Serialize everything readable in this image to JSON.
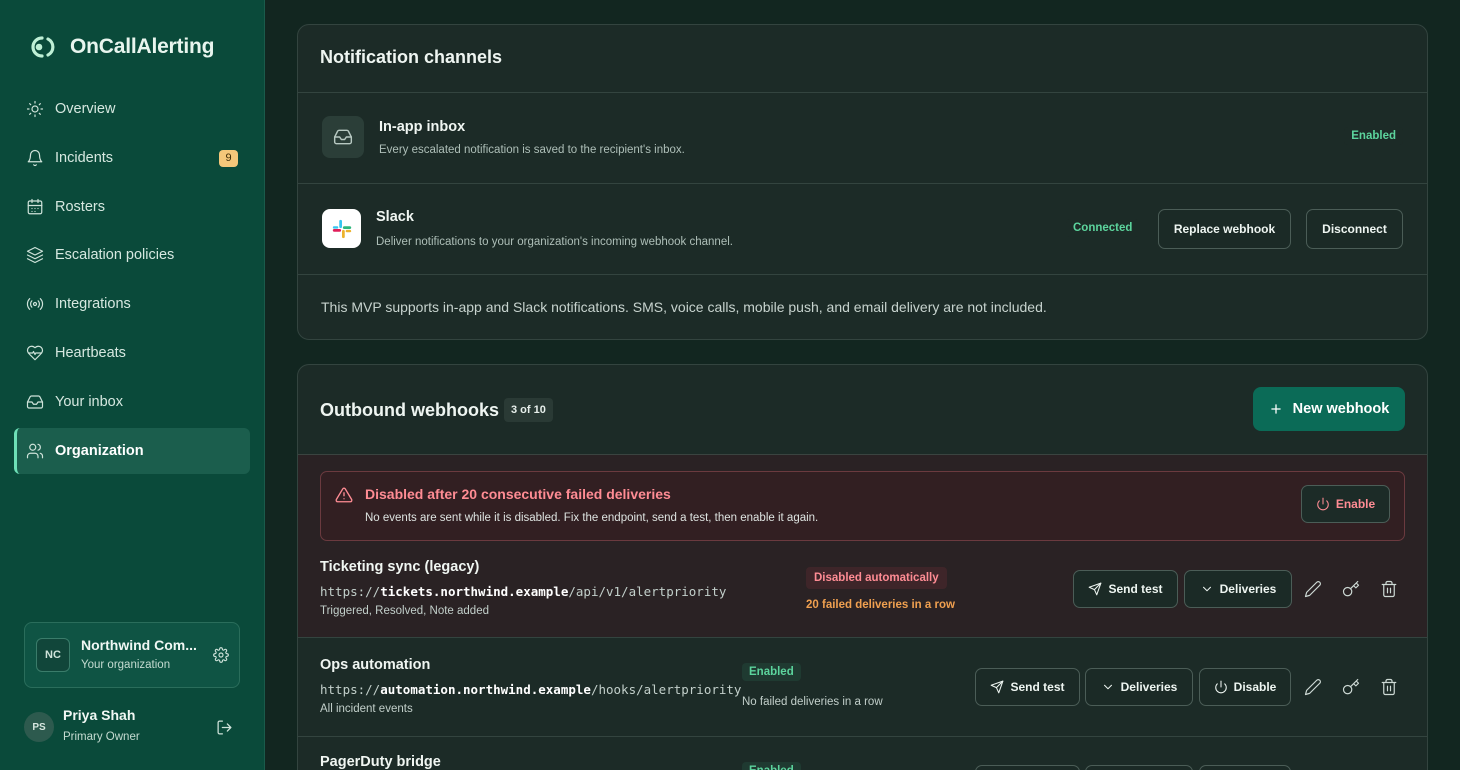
{
  "app": {
    "name": "OnCallAlerting"
  },
  "sidebar": {
    "items": [
      {
        "label": "Overview",
        "icon": "sun-icon"
      },
      {
        "label": "Incidents",
        "icon": "bell-icon",
        "badge": "9"
      },
      {
        "label": "Rosters",
        "icon": "calendar-icon"
      },
      {
        "label": "Escalation policies",
        "icon": "layers-icon"
      },
      {
        "label": "Integrations",
        "icon": "broadcast-icon"
      },
      {
        "label": "Heartbeats",
        "icon": "heartbeat-icon"
      },
      {
        "label": "Your inbox",
        "icon": "inbox-icon"
      },
      {
        "label": "Organization",
        "icon": "users-icon",
        "active": true
      }
    ],
    "org": {
      "initials": "NC",
      "name": "Northwind Com...",
      "subtitle": "Your organization"
    },
    "user": {
      "initials": "PS",
      "name": "Priya Shah",
      "role": "Primary Owner"
    }
  },
  "notification_channels": {
    "title": "Notification channels",
    "inbox": {
      "name": "In-app inbox",
      "description": "Every escalated notification is saved to the recipient's inbox.",
      "status": "Enabled"
    },
    "slack": {
      "name": "Slack",
      "description": "Deliver notifications to your organization's incoming webhook channel.",
      "status": "Connected",
      "replace_label": "Replace webhook",
      "disconnect_label": "Disconnect"
    },
    "note": "This MVP supports in-app and Slack notifications. SMS, voice calls, mobile push, and email delivery are not included."
  },
  "outbound_webhooks": {
    "title": "Outbound webhooks",
    "count": "3 of 10",
    "new_label": "New webhook",
    "alert": {
      "title": "Disabled after 20 consecutive failed deliveries",
      "message": "No events are sent while it is disabled. Fix the endpoint, send a test, then enable it again.",
      "enable_label": "Enable"
    },
    "webhooks": [
      {
        "name": "Ticketing sync (legacy)",
        "url_prefix": "https://",
        "url_host": "tickets.northwind.example",
        "url_path": "/api/v1/alertpriority",
        "events": "Triggered, Resolved, Note added",
        "status": "Disabled automatically",
        "failures": "20 failed deliveries in a row",
        "send_test": "Send test",
        "deliveries": "Deliveries"
      },
      {
        "name": "Ops automation",
        "url_prefix": "https://",
        "url_host": "automation.northwind.example",
        "url_path": "/hooks/alertpriority",
        "events": "All incident events",
        "status": "Enabled",
        "failures": "No failed deliveries in a row",
        "send_test": "Send test",
        "deliveries": "Deliveries",
        "toggle": "Disable"
      },
      {
        "name": "PagerDuty bridge",
        "status": "Enabled"
      }
    ]
  },
  "colors": {
    "accent": "#0b6b57",
    "sidebar": "#0a4a3a",
    "danger": "#ff8c94",
    "warning": "#f0a050",
    "success": "#5cd49d"
  }
}
